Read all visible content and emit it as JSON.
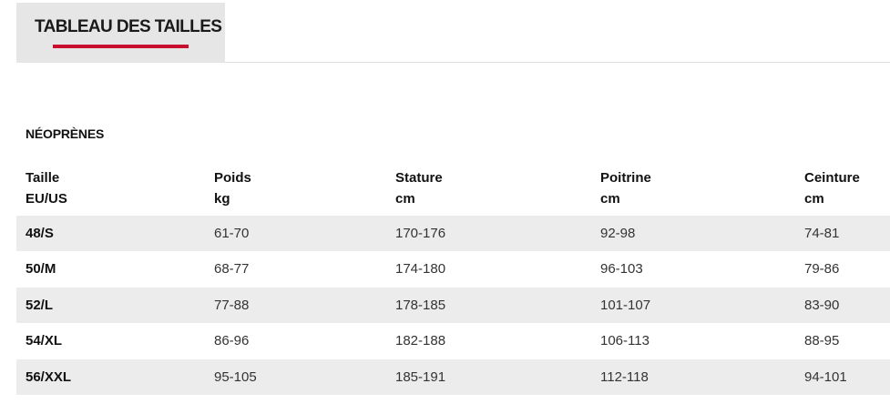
{
  "tabs": [
    {
      "label": "TABLEAU DES TAILLES",
      "active": true
    }
  ],
  "accent_color": "#c8102e",
  "section": {
    "title": "NÉOPRÈNES"
  },
  "table": {
    "headers": [
      {
        "line1": "Taille",
        "line2": "EU/US"
      },
      {
        "line1": "Poids",
        "line2": "kg"
      },
      {
        "line1": "Stature",
        "line2": "cm"
      },
      {
        "line1": "Poitrine",
        "line2": "cm"
      },
      {
        "line1": "Ceinture",
        "line2": "cm"
      }
    ],
    "rows": [
      [
        "48/S",
        "61-70",
        "170-176",
        "92-98",
        "74-81"
      ],
      [
        "50/M",
        "68-77",
        "174-180",
        "96-103",
        "79-86"
      ],
      [
        "52/L",
        "77-88",
        "178-185",
        "101-107",
        "83-90"
      ],
      [
        "54/XL",
        "86-96",
        "182-188",
        "106-113",
        "88-95"
      ],
      [
        "56/XXL",
        "95-105",
        "185-191",
        "112-118",
        "94-101"
      ]
    ]
  }
}
